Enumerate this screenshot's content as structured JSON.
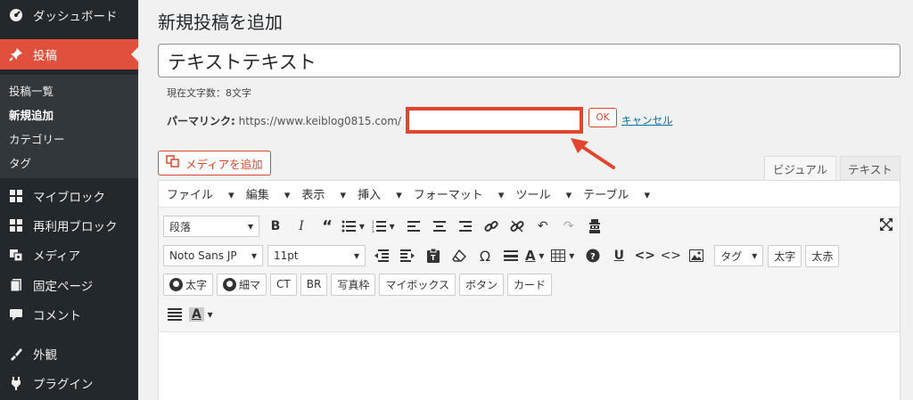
{
  "sidebar": {
    "items": [
      {
        "label": "ダッシュボード",
        "icon": "dashboard-icon"
      },
      {
        "label": "投稿",
        "icon": "pin-icon"
      },
      {
        "label": "マイブロック",
        "icon": "blocks-icon"
      },
      {
        "label": "再利用ブロック",
        "icon": "reusable-blocks-icon"
      },
      {
        "label": "メディア",
        "icon": "media-icon"
      },
      {
        "label": "固定ページ",
        "icon": "page-icon"
      },
      {
        "label": "コメント",
        "icon": "comment-icon"
      },
      {
        "label": "外観",
        "icon": "appearance-icon"
      },
      {
        "label": "プラグイン",
        "icon": "plugin-icon"
      }
    ],
    "submenu": [
      "投稿一覧",
      "新規追加",
      "カテゴリー",
      "タグ"
    ],
    "accent_color": "#e0503c"
  },
  "page": {
    "title": "新規投稿を追加",
    "post_title": "テキストテキスト",
    "char_count": "現在文字数：8文字",
    "permalink_label": "パーマリンク:",
    "permalink_url": "https://www.keiblog0815.com/",
    "slug_value": "",
    "ok_label": "OK",
    "cancel_label": "キャンセル"
  },
  "editor": {
    "media_button": "メディアを追加",
    "tabs": {
      "visual": "ビジュアル",
      "text": "テキスト"
    },
    "menus": [
      "ファイル",
      "編集",
      "表示",
      "挿入",
      "フォーマット",
      "ツール",
      "テーブル"
    ],
    "format_select": "段落",
    "font_select": "Noto Sans JP",
    "size_select": "11pt",
    "tag_select": "タグ",
    "buttons": {
      "bold_jp": "太字",
      "red_bold": "太赤",
      "circle_bold": "太字",
      "circle_thin": "細マ",
      "ct": "CT",
      "br": "BR",
      "photo_frame": "写真枠",
      "my_box": "マイボックス",
      "button": "ボタン",
      "card": "カード"
    }
  }
}
